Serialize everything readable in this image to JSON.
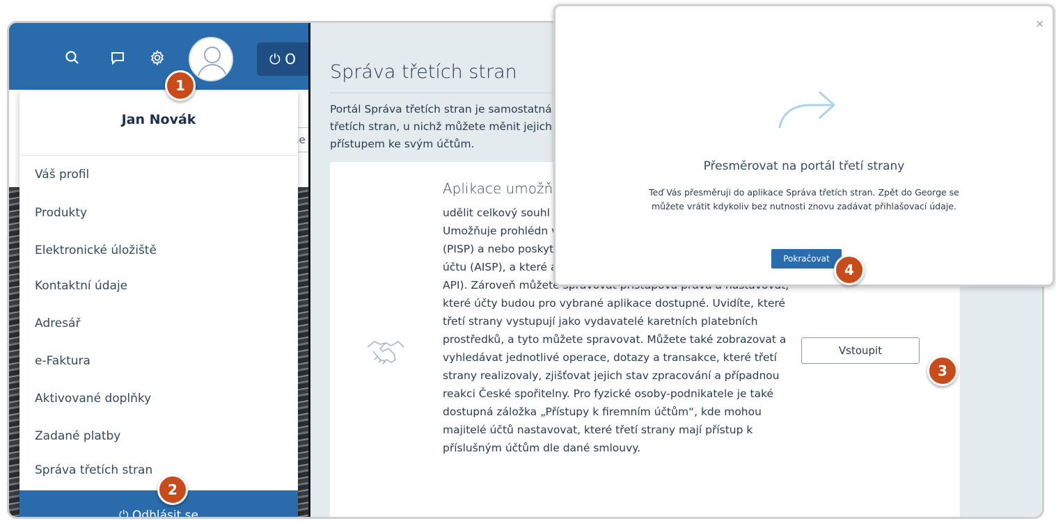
{
  "header": {
    "logout_label": "O",
    "icons": [
      "search-icon",
      "chat-icon",
      "gear-icon"
    ]
  },
  "partial_input": "ne",
  "user_menu": {
    "name": "Jan Novák",
    "items": [
      {
        "label": "Váš profil"
      },
      {
        "label": "Produkty"
      },
      {
        "label": "Elektronické úložiště"
      },
      {
        "label": "Kontaktní údaje"
      },
      {
        "label": "Adresář"
      },
      {
        "label": "e-Faktura"
      },
      {
        "label": "Aktivované doplňky"
      },
      {
        "label": "Zadané platby"
      },
      {
        "label": "Správa třetích stran"
      }
    ],
    "logout_label": "⏻ Odhlásit se"
  },
  "page": {
    "title": "Správa třetích stran",
    "intro": "Portál Správa třetích stran je samostatná třetích stran, u nichž můžete měnit jejich přístupem ke svým účtům."
  },
  "card": {
    "title": "Aplikace umožňu",
    "body": "udělit celkový souhl účtům v České spoři Vaše účty do aplikac Umožňuje prohlédn vybrané jako poskyt platebního příkazu (PISP) a nebo poskytovatele služby informování o platebním účtu (AISP), a které aplikace využívají API České spořitelny (ČS API). Zároveň můžete spravovat přístupová práva a nastavovat, které účty budou pro vybrané aplikace dostupné. Uvidíte, které třetí strany vystupují jako vydavatelé karetních platebních prostředků, a tyto můžete spravovat. Můžete také zobrazovat a vyhledávat jednotlivé operace, dotazy a transakce, které třetí strany realizovaly, zjišťovat jejich stav zpracování a případnou reakci České spořitelny. Pro fyzické osoby-podnikatele je také dostupná záložka „Přístupy k firemním účtům“, kde mohou majitelé účtů nastavovat, které třetí strany mají přístup k příslušným účtům dle dané smlouvy.",
    "button_label": "Vstoupit"
  },
  "modal": {
    "close_label": "×",
    "title": "Přesměrovat na portál třetí strany",
    "text": "Teď Vás přesměruji do aplikace Správa třetích stran. Zpět do George se můžete vrátit kdykoliv bez nutnosti znovu zadávat přihlašovací údaje.",
    "button_label": "Pokračovat"
  },
  "markers": [
    "1",
    "2",
    "3",
    "4"
  ],
  "colors": {
    "primary": "#2a6bab",
    "marker": "#c84b1c",
    "background": "#e4ebef"
  }
}
